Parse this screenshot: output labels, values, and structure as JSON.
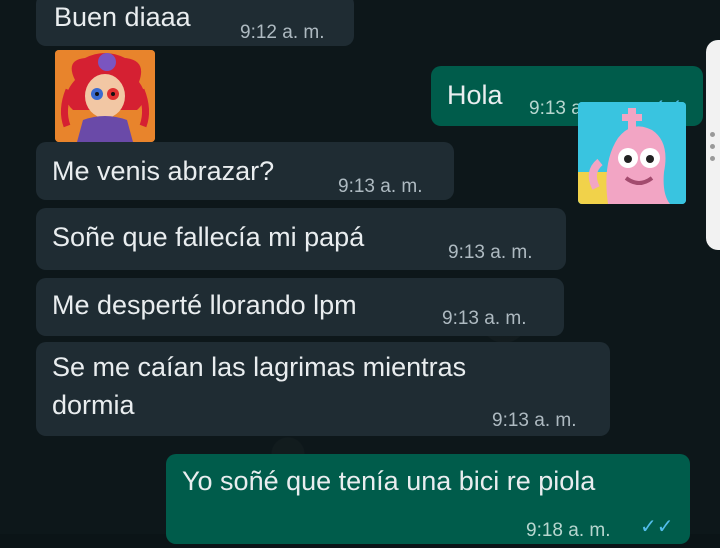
{
  "chat": {
    "messages": [
      {
        "direction": "incoming",
        "text": "Buen diaaa",
        "time": "9:12 a. m."
      },
      {
        "direction": "incoming",
        "type": "sticker",
        "sticker": "ragdoll-jester-sticker"
      },
      {
        "direction": "outgoing",
        "text": "Hola",
        "time": "9:13 a. m.",
        "status": "read"
      },
      {
        "direction": "outgoing",
        "type": "sticker",
        "sticker": "pink-chess-creature-sticker"
      },
      {
        "direction": "incoming",
        "text": "Me venis abrazar?",
        "time": "9:13 a. m."
      },
      {
        "direction": "incoming",
        "text": "Soñe que fallecía mi papá",
        "time": "9:13 a. m."
      },
      {
        "direction": "incoming",
        "text": "Me desperté llorando lpm",
        "time": "9:13 a. m."
      },
      {
        "direction": "incoming",
        "text_line1": "Se me caían las lagrimas mientras",
        "text_line2": "dormia",
        "time": "9:13 a. m."
      },
      {
        "direction": "outgoing",
        "text": "Yo soñé que tenía una bici re piola",
        "time": "9:18 a. m.",
        "status": "read"
      }
    ]
  },
  "colors": {
    "incoming_bubble": "#1f2c33",
    "outgoing_bubble": "#005c4b",
    "read_ticks": "#53bdeb",
    "background": "#0d171a"
  },
  "icons": {
    "read_receipt": "double-check-icon"
  }
}
